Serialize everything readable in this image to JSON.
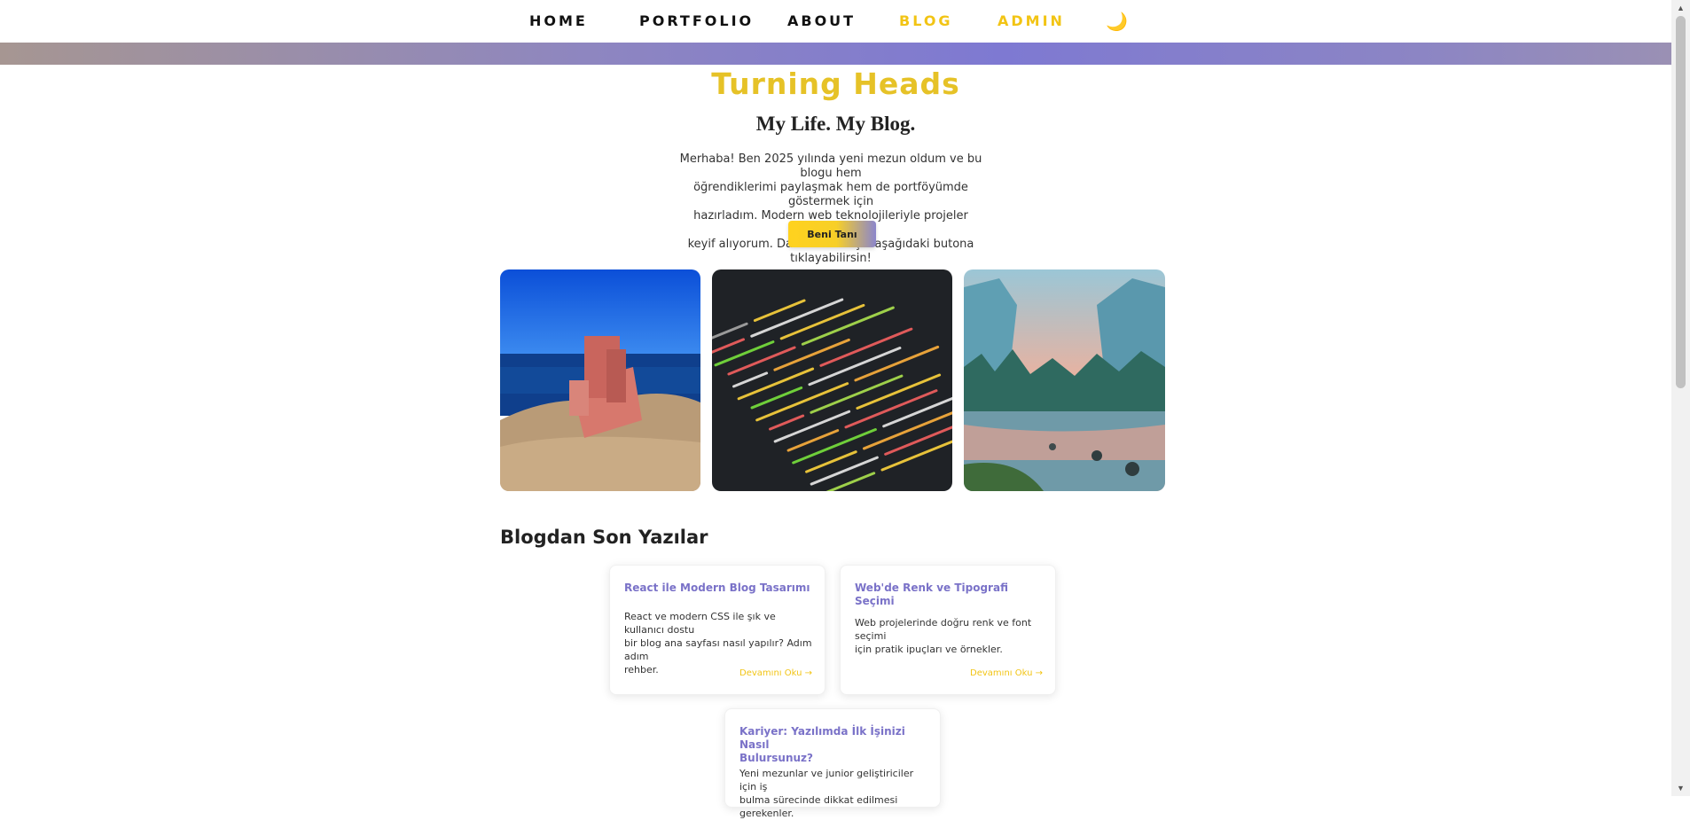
{
  "nav": {
    "items": [
      {
        "label": "HOME"
      },
      {
        "label": "PORTFOLIO"
      },
      {
        "label": "ABOUT"
      },
      {
        "label": "BLOG"
      },
      {
        "label": "ADMIN"
      }
    ],
    "theme_toggle_icon": "moon-icon",
    "theme_toggle_glyph": "🌙"
  },
  "hero": {
    "title": "Turning Heads",
    "subtitle": "My Life. My Blog.",
    "intro_lines": [
      "Merhaba! Ben 2025 yılında yeni mezun oldum ve bu blogu hem",
      "öğrendiklerimi paylaşmak hem de portföyümde göstermek için",
      "hazırladım. Modern web teknolojileriyle projeler geliştirmekten",
      "keyif alıyorum. Daha fazlası için aşağıdaki butona tıklayabilirsin!"
    ],
    "cta_label": "Beni Tanı"
  },
  "gallery": {
    "images": [
      {
        "name": "armchair-by-sea-photo"
      },
      {
        "name": "code-screen-photo"
      },
      {
        "name": "mountain-river-photo"
      }
    ]
  },
  "blog": {
    "section_title": "Blogdan Son Yazılar",
    "posts": [
      {
        "title": "React ile Modern Blog Tasarımı",
        "excerpt_lines": [
          "React ve modern CSS ile şık ve kullanıcı dostu",
          "bir blog ana sayfası nasıl yapılır? Adım adım",
          "rehber."
        ],
        "more_label": "Devamını Oku →"
      },
      {
        "title": "Web'de Renk ve Tipografi Seçimi",
        "excerpt_lines": [
          "Web projelerinde doğru renk ve font seçimi",
          "için pratik ipuçları ve örnekler."
        ],
        "more_label": "Devamını Oku →"
      },
      {
        "title_lines": [
          "Kariyer: Yazılımda İlk İşinizi Nasıl",
          "Bulursunuz?"
        ],
        "excerpt_lines": [
          "Yeni mezunlar ve junior geliştiriciler için iş",
          "bulma sürecinde dikkat edilmesi gerekenler."
        ]
      }
    ]
  },
  "colors": {
    "accent_yellow": "#f2c414",
    "accent_purple": "#7a72c8"
  }
}
